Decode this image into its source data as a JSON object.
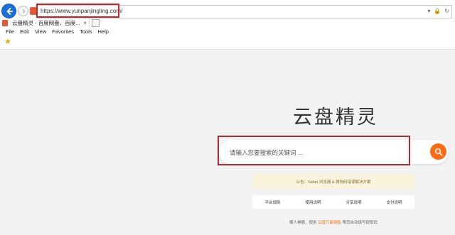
{
  "browser": {
    "url": "https://www.yunpanjingling.com/",
    "tab_title": "云盘精灵 - 百度网盘、百度...",
    "tab_close": "×",
    "menu": [
      "File",
      "Edit",
      "View",
      "Favorites",
      "Tools",
      "Help"
    ],
    "addr_icons": [
      "▾",
      "🔒",
      "↻"
    ]
  },
  "page": {
    "logo": "云盘精灵",
    "search_placeholder": "请输入您要搜索的关键词 ...",
    "notice": "公告：Safari 浏览器 & 搜狗码错误解决方案",
    "links": [
      "平台规则",
      "使用说明",
      "分享说明",
      "支付说明"
    ],
    "footer_prefix": "懒人神器，使用",
    "footer_accent": "云盘万能钥匙",
    "footer_suffix": "帮您自动填写提取码"
  },
  "colors": {
    "accent": "#ff6a13",
    "highlight": "#c0262b",
    "nav_blue": "#1d6fd8"
  }
}
